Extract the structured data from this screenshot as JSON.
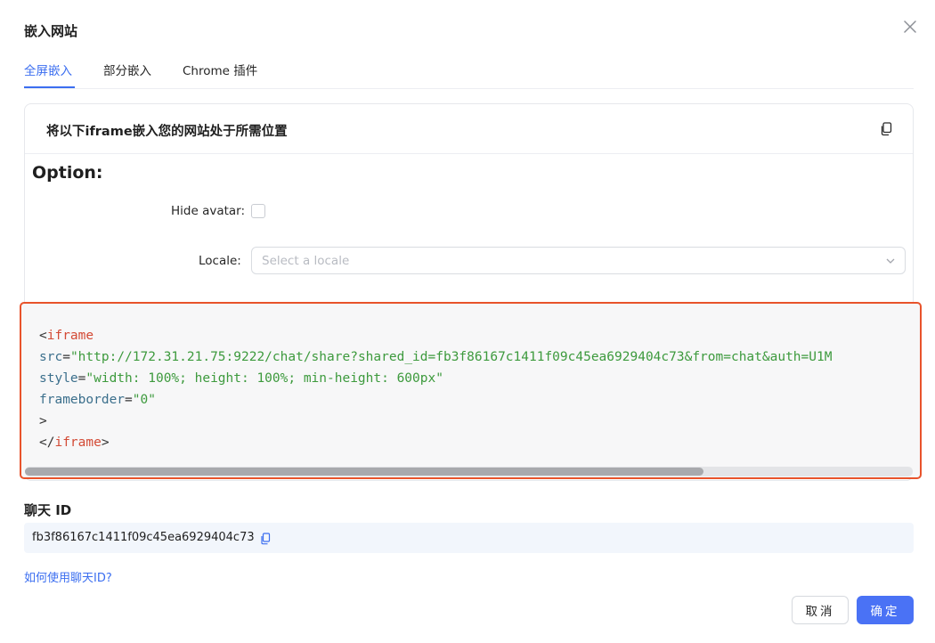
{
  "modal": {
    "title": "嵌入网站"
  },
  "tabs": [
    {
      "label": "全屏嵌入",
      "active": true
    },
    {
      "label": "部分嵌入",
      "active": false
    },
    {
      "label": "Chrome 插件",
      "active": false
    }
  ],
  "card": {
    "title": "将以下iframe嵌入您的网站处于所需位置",
    "option_title": "Option:",
    "hide_avatar_label": "Hide avatar",
    "hide_avatar_checked": false,
    "locale_label": "Locale",
    "locale_placeholder": "Select a locale"
  },
  "code": {
    "open_bracket": "<",
    "tag": "iframe",
    "src_attr": "src",
    "src_value": "\"http://172.31.21.75:9222/chat/share?shared_id=fb3f86167c1411f09c45ea6929404c73&from=chat&auth=U1M",
    "style_attr": "style",
    "style_value": "\"width: 100%; height: 100%; min-height: 600px\"",
    "frameborder_attr": "frameborder",
    "frameborder_value": "\"0\"",
    "close_bracket": ">",
    "end_open": "</",
    "end_tag": "iframe",
    "end_close": ">",
    "equals": "="
  },
  "chat_id": {
    "label": "聊天 ID",
    "value": "fb3f86167c1411f09c45ea6929404c73"
  },
  "help_link": "如何使用聊天ID?",
  "buttons": {
    "cancel": "取消",
    "ok": "确定"
  },
  "colors": {
    "accent": "#3b6ef0",
    "highlight_border": "#e8532b",
    "primary_button": "#4a72f5"
  }
}
